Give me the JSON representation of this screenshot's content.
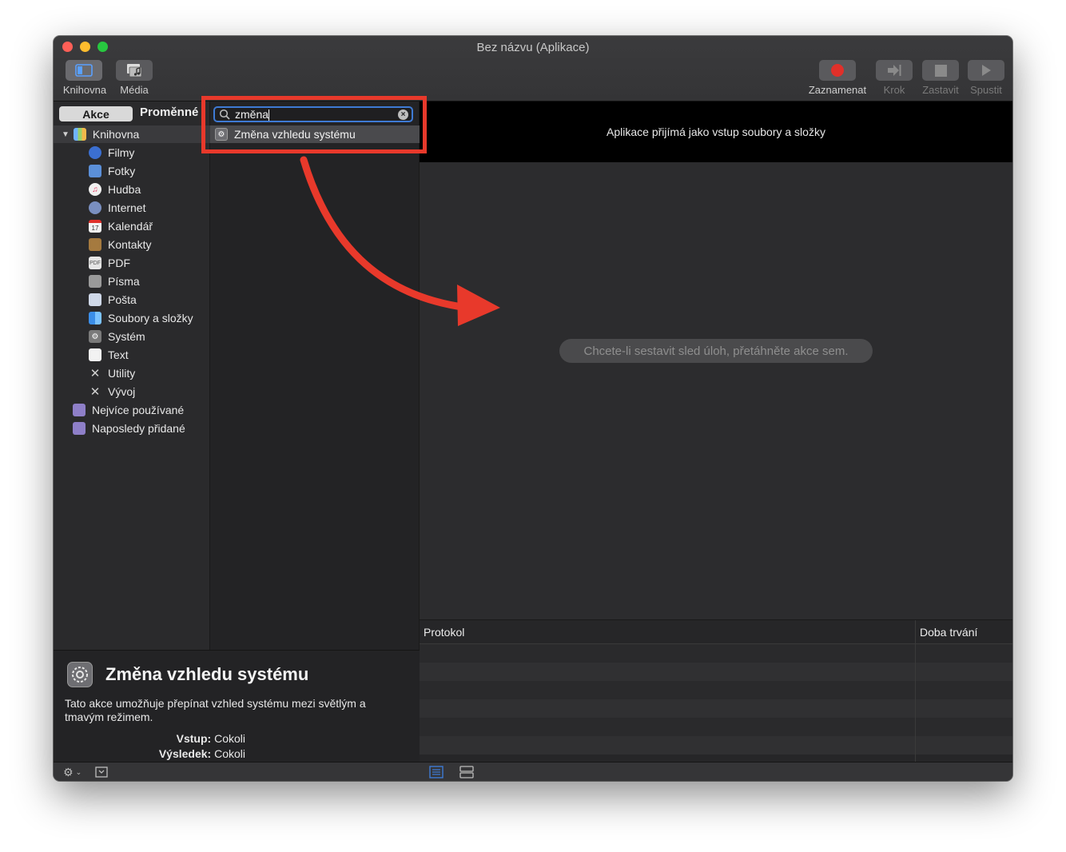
{
  "window": {
    "title": "Bez názvu (Aplikace)"
  },
  "toolbar": {
    "library_label": "Knihovna",
    "media_label": "Média",
    "record_label": "Zaznamenat",
    "step_label": "Krok",
    "stop_label": "Zastavit",
    "run_label": "Spustit"
  },
  "colors": {
    "accent": "#3e7ad4",
    "record": "#e0302a",
    "highlight": "#e8392b"
  },
  "library": {
    "tab_actions": "Akce",
    "tab_variables": "Proměnné",
    "root_label": "Knihovna",
    "items": [
      {
        "label": "Filmy",
        "icon": "film-icon"
      },
      {
        "label": "Fotky",
        "icon": "photos-icon"
      },
      {
        "label": "Hudba",
        "icon": "music-icon"
      },
      {
        "label": "Internet",
        "icon": "internet-icon"
      },
      {
        "label": "Kalendář",
        "icon": "calendar-icon"
      },
      {
        "label": "Kontakty",
        "icon": "contacts-icon"
      },
      {
        "label": "PDF",
        "icon": "pdf-icon"
      },
      {
        "label": "Písma",
        "icon": "fonts-icon"
      },
      {
        "label": "Pošta",
        "icon": "mail-icon"
      },
      {
        "label": "Soubory a složky",
        "icon": "finder-icon"
      },
      {
        "label": "Systém",
        "icon": "system-icon"
      },
      {
        "label": "Text",
        "icon": "text-icon"
      },
      {
        "label": "Utility",
        "icon": "utility-icon"
      },
      {
        "label": "Vývoj",
        "icon": "developer-icon"
      }
    ],
    "smart_groups": [
      {
        "label": "Nejvíce používané",
        "icon": "smart-folder-icon"
      },
      {
        "label": "Naposledy přidané",
        "icon": "smart-folder-icon"
      }
    ]
  },
  "search": {
    "value": "změna",
    "results": [
      {
        "label": "Změna vzhledu systému",
        "icon": "system-preferences-icon"
      }
    ]
  },
  "workflow": {
    "input_banner": "Aplikace přijímá jako vstup soubory a složky",
    "empty_hint": "Chcete-li sestavit sled úloh, přetáhněte akce sem."
  },
  "log": {
    "col_protocol": "Protokol",
    "col_duration": "Doba trvání"
  },
  "description": {
    "title": "Změna vzhledu systému",
    "text": "Tato akce umožňuje přepínat vzhled systému mezi světlým a tmavým režimem.",
    "input_key": "Vstup:",
    "input_value": "Cokoli",
    "output_key": "Výsledek:",
    "output_value": "Cokoli"
  }
}
